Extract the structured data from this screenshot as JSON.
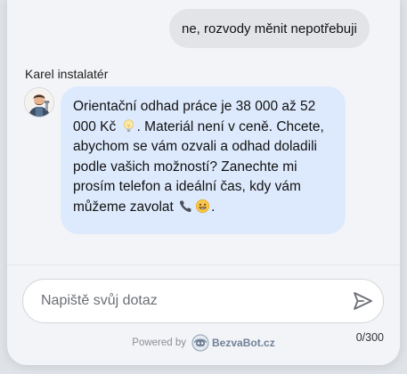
{
  "conversation": {
    "user_message": "ne, rozvody měnit nepotřebuji",
    "agent_name": "Karel instalatér",
    "bot_message": {
      "part1": "Orientační odhad práce je 38 000 až 52 000 Kč ",
      "emoji1": "lightbulb-icon",
      "part2": ". Materiál není v ceně. Chcete, abychom se vám ozvali a odhad doladili podle vašich možností? Zanechte mi prosím telefon a ideální čas, kdy vám můžeme zavolat ",
      "emoji2": "telephone-icon",
      "emoji3": "grinning-face-icon",
      "part3": "."
    }
  },
  "composer": {
    "placeholder": "Napiště svůj dotaz",
    "value": "",
    "counter": "0/300"
  },
  "footer": {
    "powered_by": "Powered by",
    "brand": "BezvaBot.cz"
  },
  "colors": {
    "bot_bubble": "#ddeafd",
    "user_bubble": "#e3e4e8",
    "brand": "#6f8198"
  }
}
